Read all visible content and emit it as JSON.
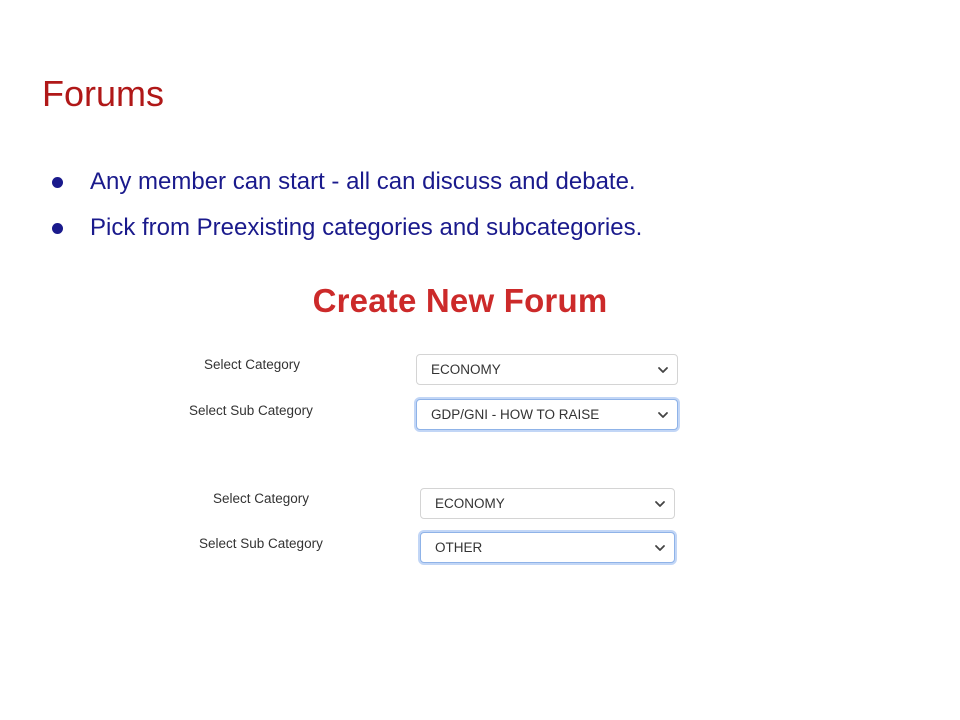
{
  "slide": {
    "title": "Forums",
    "bullets": [
      "Any member can start - all can discuss and debate.",
      "Pick from Preexisting categories and subcategories."
    ]
  },
  "form": {
    "heading": "Create New Forum",
    "groups": [
      {
        "category_label": "Select Category",
        "category_value": "ECONOMY",
        "subcategory_label": "Select Sub Category",
        "subcategory_value": "GDP/GNI - HOW TO RAISE"
      },
      {
        "category_label": "Select Category",
        "category_value": "ECONOMY",
        "subcategory_label": "Select Sub Category",
        "subcategory_value": "OTHER"
      }
    ]
  },
  "colors": {
    "title": "#b01818",
    "bullets": "#1a1a8c",
    "heading": "#cc2a2a"
  },
  "icons": {
    "bullet": "bullet-dot-icon",
    "dropdown": "chevron-down-icon"
  }
}
